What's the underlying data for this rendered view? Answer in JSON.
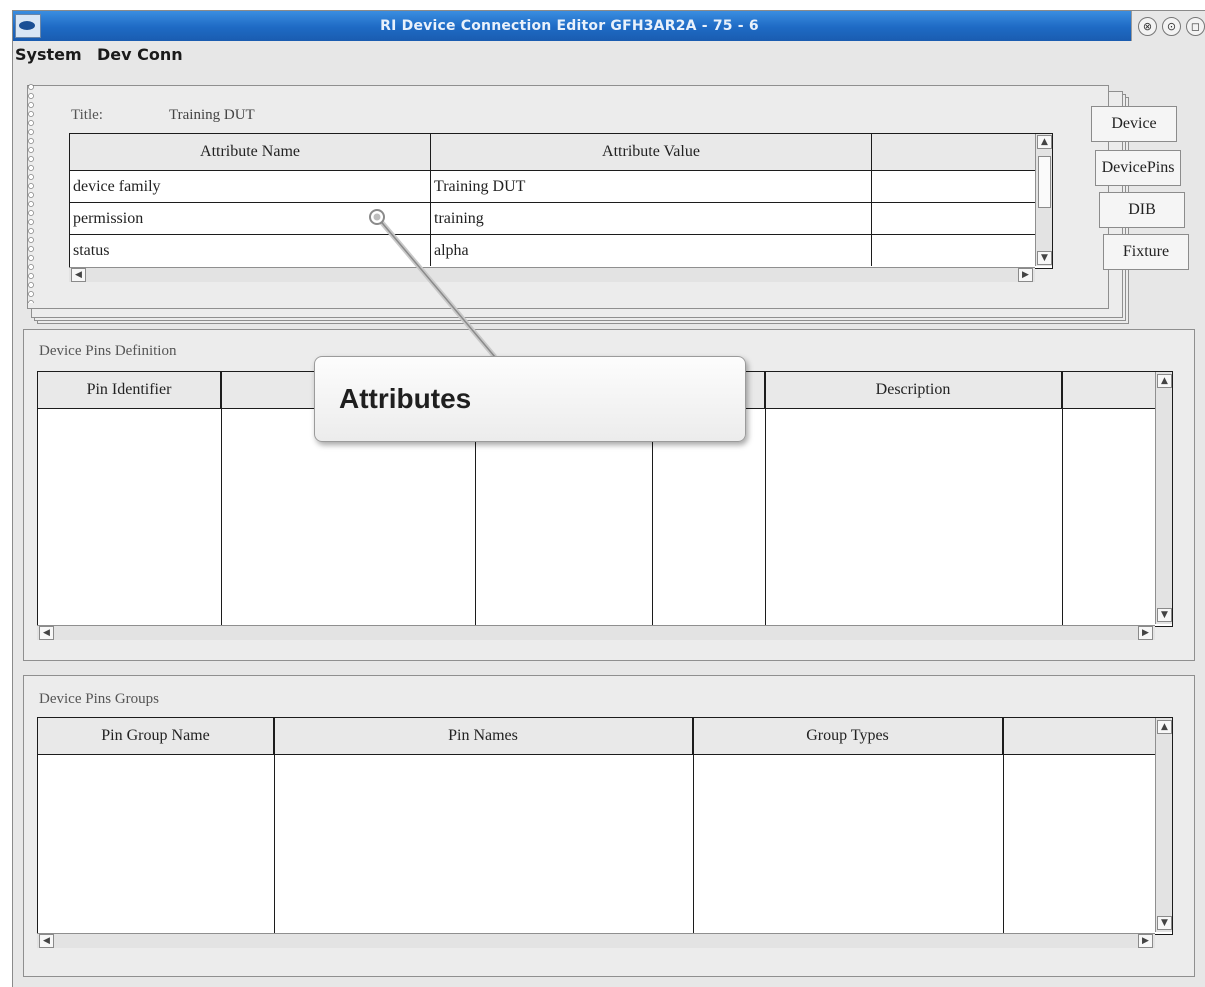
{
  "window": {
    "title": "RI Device Connection Editor GFH3AR2A - 75 - 6",
    "controls": [
      "⊗",
      "⊙",
      "◻"
    ]
  },
  "menu": {
    "items": [
      {
        "label": "System",
        "mnemonic": "S"
      },
      {
        "label": "Dev Conn",
        "mnemonic": "D"
      }
    ]
  },
  "notebook": {
    "title_label": "Title:",
    "title_value": "Training DUT",
    "tabs": [
      "Device",
      "DevicePins",
      "DIB",
      "Fixture"
    ],
    "attributes_table": {
      "headers": [
        "Attribute Name",
        "Attribute Value",
        ""
      ],
      "rows": [
        [
          "device family",
          "Training DUT",
          ""
        ],
        [
          "permission",
          "training",
          ""
        ],
        [
          "status",
          "alpha",
          ""
        ]
      ]
    }
  },
  "device_pins_definition": {
    "label": "Device Pins Definition",
    "headers": [
      "Pin Identifier",
      "",
      "",
      "",
      "Description",
      ""
    ]
  },
  "device_pins_groups": {
    "label": "Device Pins Groups",
    "headers": [
      "Pin Group Name",
      "Pin Names",
      "Group Types",
      ""
    ]
  },
  "callout": {
    "text": "Attributes"
  },
  "colors": {
    "titlebar": "#1e6ac4",
    "window_bg": "#e7e7e7",
    "table_bg": "#ffffff"
  }
}
